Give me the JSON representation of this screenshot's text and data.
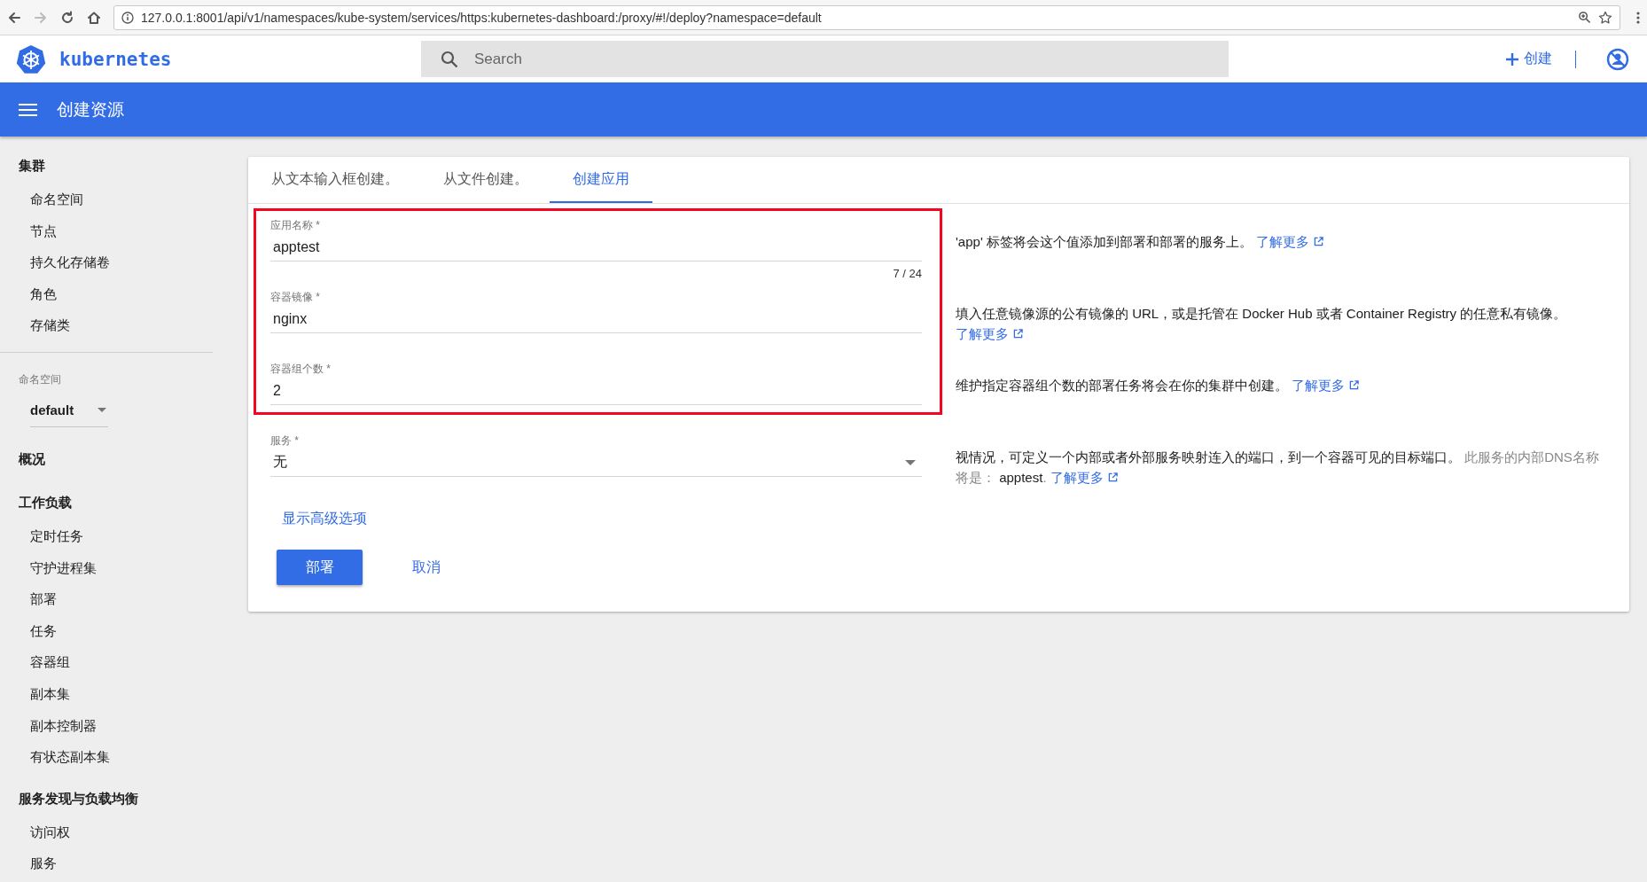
{
  "browser": {
    "url": "127.0.0.1:8001/api/v1/namespaces/kube-system/services/https:kubernetes-dashboard:/proxy/#!/deploy?namespace=default"
  },
  "header": {
    "logo_text": "kubernetes",
    "search": {
      "placeholder": "Search"
    },
    "create_button": "创建"
  },
  "toolbar": {
    "title": "创建资源"
  },
  "sidebar": {
    "entries": [
      {
        "kind": "section",
        "title": "集群",
        "items": [
          "命名空间",
          "节点",
          "持久化存储卷",
          "角色",
          "存储类"
        ]
      },
      {
        "kind": "namespace",
        "label": "命名空间",
        "value": "default"
      },
      {
        "kind": "section",
        "title": "概况"
      },
      {
        "kind": "section",
        "title": "工作负载",
        "items": [
          "定时任务",
          "守护进程集",
          "部署",
          "任务",
          "容器组",
          "副本集",
          "副本控制器",
          "有状态副本集"
        ]
      },
      {
        "kind": "section",
        "title": "服务发现与负载均衡",
        "items": [
          "访问权",
          "服务"
        ]
      }
    ]
  },
  "tabs": [
    {
      "label": "从文本输入框创建。",
      "selected": false
    },
    {
      "label": "从文件创建。",
      "selected": false
    },
    {
      "label": "创建应用",
      "selected": true
    }
  ],
  "form": {
    "fields": [
      {
        "kind": "input",
        "label": "应用名称 *",
        "value": "apptest",
        "counter": "7 / 24",
        "highlighted": true,
        "help": [
          {
            "kind": "text",
            "text": "'app' 标签将会这个值添加到部署和部署的服务上。 "
          },
          {
            "kind": "link",
            "text": "了解更多"
          }
        ]
      },
      {
        "kind": "input",
        "label": "容器镜像 *",
        "value": "nginx",
        "highlighted": true,
        "help": [
          {
            "kind": "text",
            "text": "填入任意镜像源的公有镜像的 URL，或是托管在 Docker Hub 或者 Container Registry 的任意私有镜像。 "
          },
          {
            "kind": "link",
            "text": "了解更多"
          }
        ]
      },
      {
        "kind": "input",
        "label": "容器组个数 *",
        "value": "2",
        "highlighted": true,
        "help": [
          {
            "kind": "text",
            "text": "维护指定容器组个数的部署任务将会在你的集群中创建。 "
          },
          {
            "kind": "link",
            "text": "了解更多"
          }
        ]
      },
      {
        "kind": "select",
        "label": "服务 *",
        "value": "无",
        "highlighted": false,
        "help": [
          {
            "kind": "text",
            "text": "视情况，可定义一个内部或者外部服务映射连入的端口，到一个容器可见的目标端口。 "
          },
          {
            "kind": "muted",
            "text": "此服务的内部DNS名称将是： "
          },
          {
            "kind": "text",
            "text": "apptest"
          },
          {
            "kind": "muted",
            "text": ". "
          },
          {
            "kind": "link",
            "text": "了解更多"
          }
        ]
      }
    ],
    "advanced_link": "显示高级选项",
    "buttons": [
      {
        "kind": "primary",
        "label": "部署"
      },
      {
        "kind": "flat",
        "label": "取消"
      }
    ]
  }
}
